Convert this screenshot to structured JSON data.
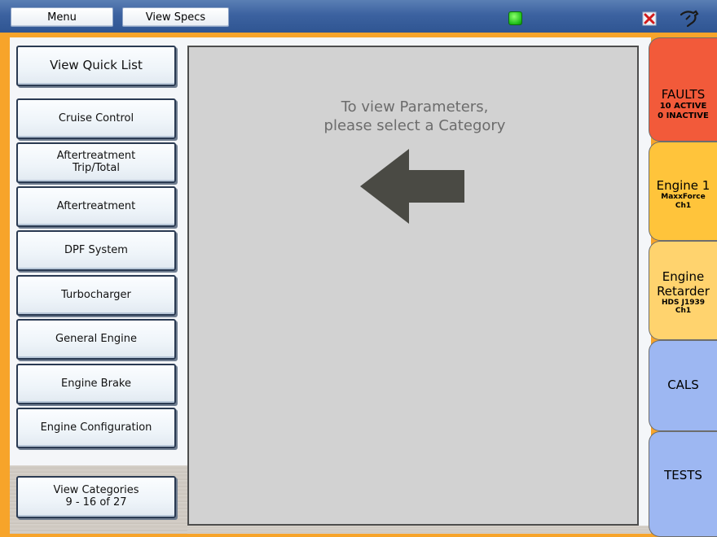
{
  "toolbar": {
    "menu_label": "Menu",
    "specs_label": "View Specs",
    "status_color": "#1fbf1a"
  },
  "categories": [
    {
      "label": "View Quick List"
    },
    {
      "label": "Cruise Control"
    },
    {
      "label": "Aftertreatment\nTrip/Total"
    },
    {
      "label": "Aftertreatment"
    },
    {
      "label": "DPF System"
    },
    {
      "label": "Turbocharger"
    },
    {
      "label": "General Engine"
    },
    {
      "label": "Engine Brake"
    },
    {
      "label": "Engine Configuration"
    }
  ],
  "pager": {
    "line1": "View Categories",
    "line2": "9 - 16 of 27"
  },
  "main": {
    "prompt_line1": "To view Parameters,",
    "prompt_line2": "please select a Category",
    "arrow_icon": "left-arrow-icon"
  },
  "tabs": {
    "faults": {
      "title": "FAULTS",
      "line1": "10 ACTIVE",
      "line2": "0 INACTIVE",
      "color": "#f25a3a"
    },
    "engine1": {
      "title": "Engine 1",
      "line1": "MaxxForce",
      "line2": "Ch1",
      "color": "#ffc43b"
    },
    "retarder": {
      "title_line1": "Engine",
      "title_line2": "Retarder",
      "line1": "HDS J1939",
      "line2": "Ch1",
      "color": "#ffd36e"
    },
    "cals": {
      "title": "CALS",
      "color": "#9db7f2"
    },
    "tests": {
      "title": "TESTS",
      "color": "#9db7f2"
    }
  }
}
